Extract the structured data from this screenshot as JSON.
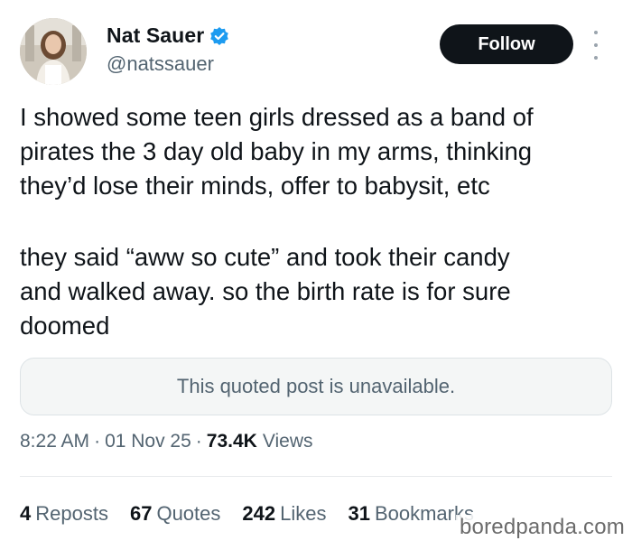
{
  "author": {
    "name": "Nat Sauer",
    "handle": "@natssauer",
    "verified_icon": "verified-badge-icon",
    "verified_color": "#1d9bf0"
  },
  "follow_button": {
    "label": "Follow"
  },
  "more_menu": {
    "icon": "more-vertical-icon"
  },
  "post": {
    "paragraph1": [
      "I showed some teen girls dressed as a band of",
      "pirates the 3 day old baby in my arms, thinking",
      "they’d lose their minds, offer to babysit, etc"
    ],
    "paragraph2": [
      "they said “aww so cute” and took their candy",
      "and walked away. so the birth rate is for sure",
      "doomed"
    ]
  },
  "quoted_post": {
    "text": "This quoted post is unavailable."
  },
  "meta": {
    "time": "8:22 AM",
    "date": "01 Nov 25",
    "views_count": "73.4K",
    "views_label": "Views",
    "separator": "·"
  },
  "stats": {
    "reposts": {
      "count": "4",
      "label": "Reposts"
    },
    "quotes": {
      "count": "67",
      "label": "Quotes"
    },
    "likes": {
      "count": "242",
      "label": "Likes"
    },
    "bookmarks": {
      "count": "31",
      "label": "Bookmarks"
    }
  },
  "watermark": {
    "text": "boredpanda.com"
  },
  "colors": {
    "text_primary": "#0f1419",
    "text_secondary": "#536471",
    "button_bg": "#0f1419",
    "quote_bg": "#f4f6f6"
  }
}
